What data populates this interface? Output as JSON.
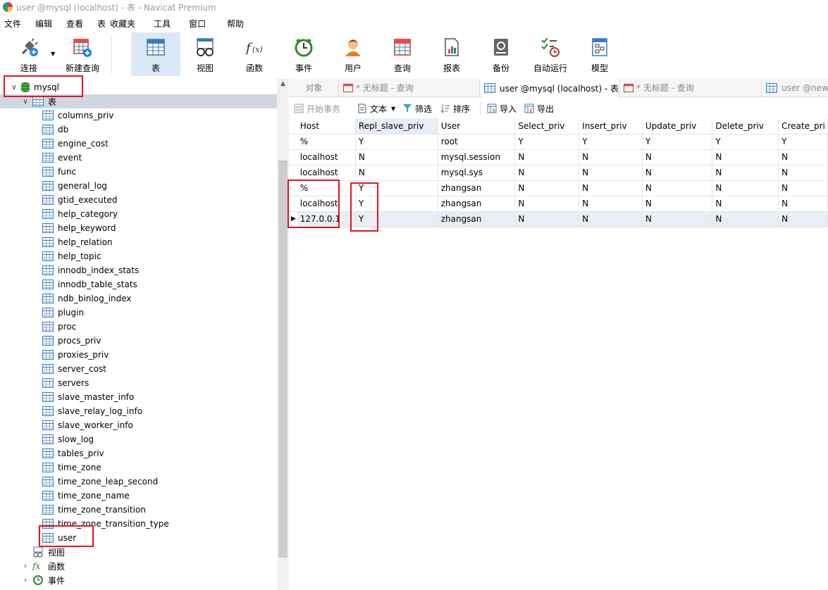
{
  "window": {
    "title": "user @mysql (localhost) - 表 - Navicat Premium"
  },
  "menu": [
    "文件",
    "编辑",
    "查看",
    "表",
    "收藏夹",
    "工具",
    "窗口",
    "帮助"
  ],
  "toolbar": {
    "connect": "连接",
    "new_query": "新建查询",
    "table": "表",
    "view": "视图",
    "function": "函数",
    "event": "事件",
    "user": "用户",
    "query": "查询",
    "report": "报表",
    "backup": "备份",
    "automation": "自动运行",
    "model": "模型"
  },
  "navigator": {
    "database": "mysql",
    "tables_group": "表",
    "tables": [
      "columns_priv",
      "db",
      "engine_cost",
      "event",
      "func",
      "general_log",
      "gtid_executed",
      "help_category",
      "help_keyword",
      "help_relation",
      "help_topic",
      "innodb_index_stats",
      "innodb_table_stats",
      "ndb_binlog_index",
      "plugin",
      "proc",
      "procs_priv",
      "proxies_priv",
      "server_cost",
      "servers",
      "slave_master_info",
      "slave_relay_log_info",
      "slave_worker_info",
      "slow_log",
      "tables_priv",
      "time_zone",
      "time_zone_leap_second",
      "time_zone_name",
      "time_zone_transition",
      "time_zone_transition_type",
      "user"
    ],
    "views_group": "视图",
    "functions_group": "函数",
    "events_group": "事件"
  },
  "tabs": [
    "对象",
    "* 无标题 - 查询",
    "user @mysql (localhost) - 表",
    "* 无标题 - 查询",
    "user @news"
  ],
  "subtoolbar": {
    "begin_transaction": "开始事务",
    "text": "文本",
    "filter": "筛选",
    "sort": "排序",
    "import": "导入",
    "export": "导出"
  },
  "grid": {
    "columns": [
      "Host",
      "Repl_slave_priv",
      "User",
      "Select_priv",
      "Insert_priv",
      "Update_priv",
      "Delete_priv",
      "Create_pri"
    ],
    "rows": [
      [
        "%",
        "Y",
        "root",
        "Y",
        "Y",
        "Y",
        "Y",
        "Y"
      ],
      [
        "localhost",
        "N",
        "mysql.session",
        "N",
        "N",
        "N",
        "N",
        "N"
      ],
      [
        "localhost",
        "N",
        "mysql.sys",
        "N",
        "N",
        "N",
        "N",
        "N"
      ],
      [
        "%",
        "Y",
        "zhangsan",
        "N",
        "N",
        "N",
        "N",
        "N"
      ],
      [
        "localhost",
        "Y",
        "zhangsan",
        "N",
        "N",
        "N",
        "N",
        "N"
      ],
      [
        "127.0.0.1",
        "Y",
        "zhangsan",
        "N",
        "N",
        "N",
        "N",
        "N"
      ]
    ],
    "current_row": 5
  },
  "colors": {
    "highlight_box": "#e8141c",
    "selection": "#cfd8e2",
    "accent": "#3d7ab8"
  }
}
